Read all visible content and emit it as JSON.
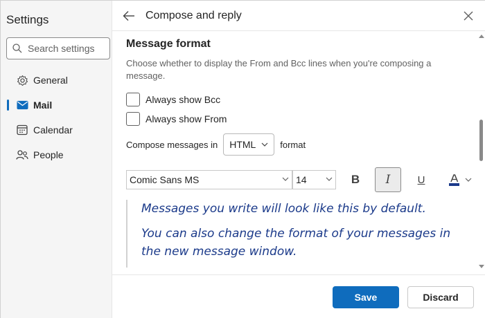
{
  "sidebar": {
    "title": "Settings",
    "search_placeholder": "Search settings",
    "items": [
      {
        "label": "General",
        "icon": "gear-icon"
      },
      {
        "label": "Mail",
        "icon": "mail-icon",
        "active": true
      },
      {
        "label": "Calendar",
        "icon": "calendar-icon"
      },
      {
        "label": "People",
        "icon": "people-icon"
      }
    ]
  },
  "header": {
    "title": "Compose and reply"
  },
  "section": {
    "title": "Message format",
    "description": "Choose whether to display the From and Bcc lines when you're composing a message.",
    "always_show_bcc": {
      "label": "Always show Bcc",
      "checked": false
    },
    "always_show_from": {
      "label": "Always show From",
      "checked": false
    },
    "compose_prefix": "Compose messages in",
    "compose_format": "HTML",
    "compose_suffix": "format"
  },
  "toolbar": {
    "font_family": "Comic Sans MS",
    "font_size": "14",
    "bold_label": "B",
    "italic_label": "I",
    "italic_active": true,
    "underline_label": "U",
    "font_color": "#1b3a8a"
  },
  "preview": {
    "line1": "Messages you write will look like this by default.",
    "line2": "You can also change the format of your messages in the new message window."
  },
  "footer": {
    "save_label": "Save",
    "discard_label": "Discard"
  },
  "colors": {
    "accent": "#0f6cbd",
    "preview_text": "#1b3a8a"
  }
}
